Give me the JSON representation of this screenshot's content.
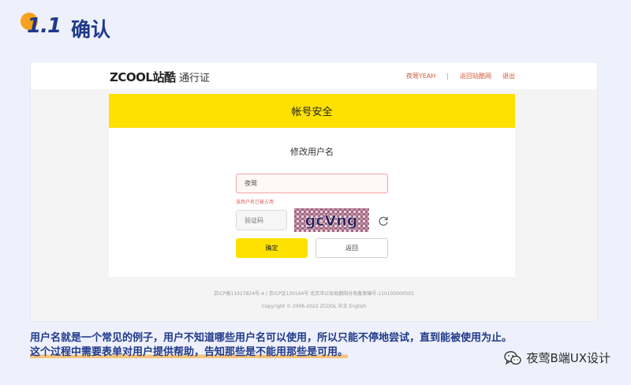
{
  "heading": {
    "number": "1.1",
    "title": "确认"
  },
  "site": {
    "logo": "ZCOOL站酷",
    "logo_sub": "通行证",
    "links": [
      "夜莺YEAH",
      "返回站酷网",
      "退出"
    ],
    "separator": "|"
  },
  "card": {
    "title": "帐号安全",
    "subtitle": "修改用户名",
    "username_value": "夜莺",
    "error_text": "该用户名已被占用",
    "code_placeholder": "验证码",
    "captcha_text": "gcVng",
    "confirm_label": "确定",
    "back_label": "返回"
  },
  "footer": {
    "line1": "京ICP备11017824号-4 / 京ICP证130164号  北京市公安局朝阳分局备案编号:110105000501",
    "line2": "Copyright © 2006-2022 ZCOOL  中文  English"
  },
  "caption": {
    "line1": "用户名就是一个常见的例子，用户不知道哪些用户名可以使用，所以只能不停地尝试，直到能被使用为止。",
    "line2": "这个过程中需要表单对用户提供帮助，告知那些是不能用那些是可用。"
  },
  "watermark": {
    "text": "夜莺B端UX设计"
  },
  "colors": {
    "accent": "#ffe100",
    "heading": "#1f3a8a",
    "error": "#e65a5a",
    "link": "#d2583a"
  }
}
